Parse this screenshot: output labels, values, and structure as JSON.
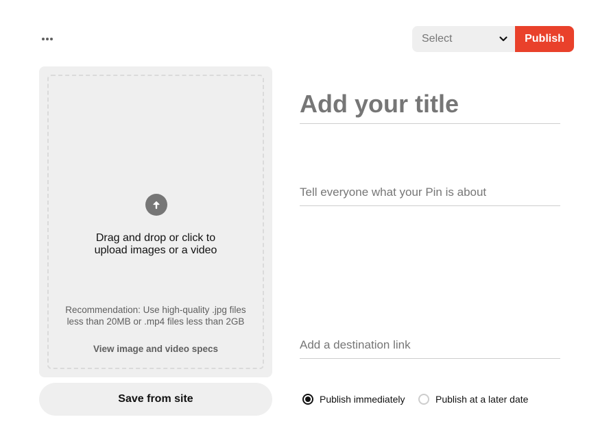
{
  "toolbar": {
    "more_icon": "more-horizontal-icon",
    "board_select": {
      "selected": "Select",
      "icon": "chevron-down-icon"
    },
    "publish_label": "Publish",
    "publish_color": "#e9412b"
  },
  "upload": {
    "icon": "arrow-up-circle-icon",
    "instruction_line1": "Drag and drop or click to",
    "instruction_line2": "upload images or a video",
    "recommendation": "Recommendation: Use high-quality .jpg files less than 20MB or .mp4 files less than 2GB",
    "specs_link": "View image and video specs"
  },
  "save_from_site_label": "Save from site",
  "form": {
    "title_placeholder": "Add your title",
    "description_placeholder": "Tell everyone what your Pin is about",
    "link_placeholder": "Add a destination link"
  },
  "publish_options": {
    "immediately_label": "Publish immediately",
    "later_label": "Publish at a later date",
    "selected": "immediately"
  }
}
